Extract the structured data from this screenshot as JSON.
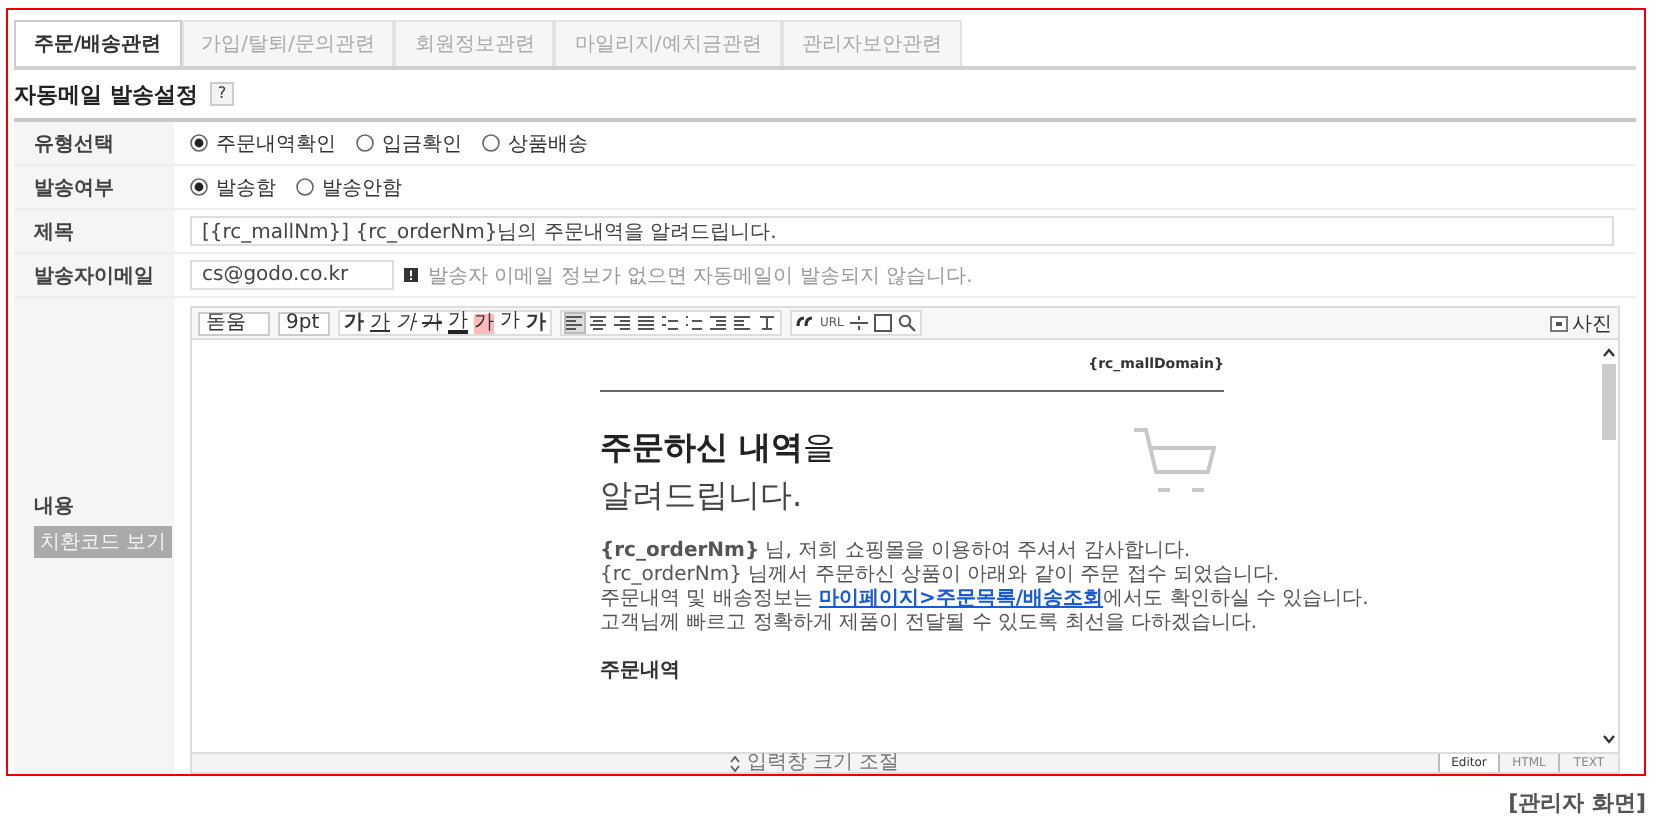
{
  "tabs": [
    {
      "label": "주문/배송관련",
      "selected": true
    },
    {
      "label": "가입/탈퇴/문의관련",
      "selected": false
    },
    {
      "label": "회원정보관련",
      "selected": false
    },
    {
      "label": "마일리지/예치금관련",
      "selected": false
    },
    {
      "label": "관리자보안관련",
      "selected": false
    }
  ],
  "section_title": "자동메일 발송설정",
  "help_label": "?",
  "rows": [
    {
      "kind": "radio",
      "label": "유형선택",
      "options": [
        {
          "label": "주문내역확인",
          "selected": true
        },
        {
          "label": "입금확인",
          "selected": false
        },
        {
          "label": "상품배송",
          "selected": false
        }
      ]
    },
    {
      "kind": "radio",
      "label": "발송여부",
      "options": [
        {
          "label": "발송함",
          "selected": true
        },
        {
          "label": "발송안함",
          "selected": false
        }
      ]
    },
    {
      "kind": "text",
      "label": "제목",
      "value": "[{rc_mallNm}] {rc_orderNm}님의 주문내역을 알려드립니다."
    },
    {
      "kind": "email",
      "label": "발송자이메일",
      "value": "cs@godo.co.kr",
      "note": "발송자 이메일 정보가 없으면 자동메일이 발송되지 않습니다."
    },
    {
      "kind": "editor",
      "label": "내용",
      "code_button": "치환코드 보기"
    }
  ],
  "editor": {
    "font": "돋움",
    "size": "9pt",
    "format_buttons": [
      {
        "label": "가",
        "kind": "bold"
      },
      {
        "label": "가",
        "kind": "underline"
      },
      {
        "label": "가",
        "kind": "italic"
      },
      {
        "label": "가",
        "kind": "strike"
      },
      {
        "label": "가",
        "kind": "color"
      },
      {
        "label": "가",
        "kind": "highlight"
      },
      {
        "label": "가",
        "kind": "sup"
      },
      {
        "label": "가",
        "kind": "sub"
      }
    ],
    "url_label": "URL",
    "photo_label": "사진",
    "content": {
      "domain": "{rc_mallDomain}",
      "heading": "**주문하신 내역**을",
      "heading_line2": "알려드립니다.",
      "paragraphs": [
        {
          "text": "**{rc_orderNm}** 님, 저희 쇼핑몰을 이용하여 주셔서 감사합니다."
        },
        {
          "text": "{rc_orderNm} 님께서 주문하신 상품이 아래와 같이 주문 접수 되었습니다."
        },
        {
          "text": "주문내역 및 배송정보는 ",
          "link": "마이페이지>주문목록/배송조회",
          "after": "에서도 확인하실 수 있습니다."
        },
        {
          "text": "고객님께 빠르고 정확하게 제품이 전달될 수 있도록 최선을 다하겠습니다."
        }
      ],
      "subheading": "주문내역"
    },
    "resize_label": "입력창 크기 조절",
    "modes": [
      {
        "label": "Editor",
        "selected": true
      },
      {
        "label": "HTML",
        "selected": false
      },
      {
        "label": "TEXT",
        "selected": false
      }
    ]
  },
  "caption": "[관리자 화면]"
}
